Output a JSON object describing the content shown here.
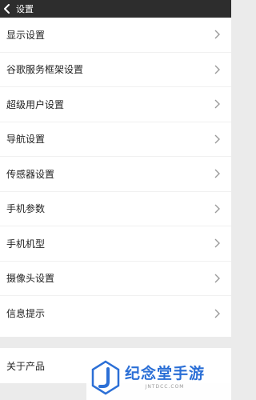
{
  "header": {
    "title": "设置"
  },
  "settings_items": [
    {
      "label": "显示设置"
    },
    {
      "label": "谷歌服务框架设置"
    },
    {
      "label": "超级用户设置"
    },
    {
      "label": "导航设置"
    },
    {
      "label": "传感器设置"
    },
    {
      "label": "手机参数"
    },
    {
      "label": "手机机型"
    },
    {
      "label": "摄像头设置"
    },
    {
      "label": "信息提示"
    }
  ],
  "about": {
    "label": "关于产品"
  },
  "watermark": {
    "brand": "纪念堂手游",
    "domain": "JNTDCC.COM",
    "color": "#2b6fd6"
  },
  "colors": {
    "header_bg": "#2d2d2d",
    "page_bg": "#ebebeb"
  }
}
